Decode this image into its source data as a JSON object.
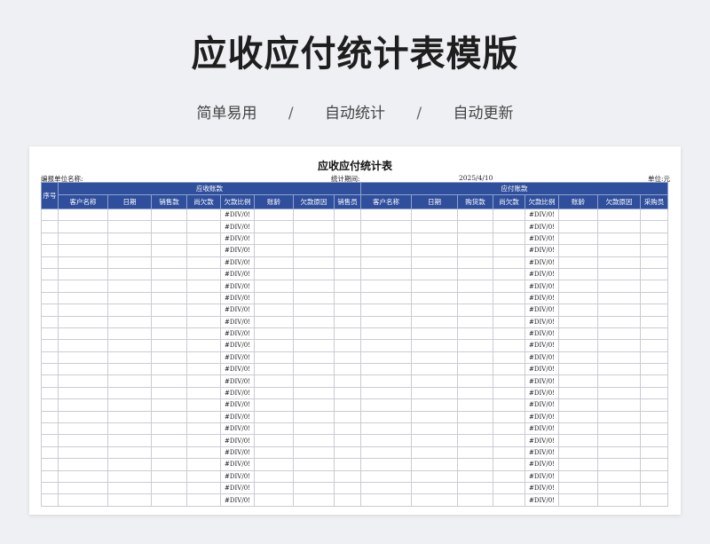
{
  "banner": {
    "title": "应收应付统计表模版",
    "tags": [
      "简单易用",
      "自动统计",
      "自动更新"
    ],
    "separator": "/"
  },
  "sheet": {
    "title": "应收应付统计表",
    "unit_label": "编报单位名称:",
    "period_label": "统计期间:",
    "period_value": "2025/4/10",
    "currency_label": "单位:元",
    "seq_header": "序号",
    "receivable_group": "应收账款",
    "payable_group": "应付账款",
    "receivable_columns": [
      "客户名称",
      "日期",
      "销售款",
      "尚欠款",
      "欠款比例",
      "账龄",
      "欠款原因",
      "销售员"
    ],
    "payable_columns": [
      "客户名称",
      "日期",
      "购货款",
      "尚欠款",
      "欠款比例",
      "账龄",
      "欠款原因",
      "采购员"
    ],
    "error_value": "#DIV/0!",
    "row_count": 25
  }
}
